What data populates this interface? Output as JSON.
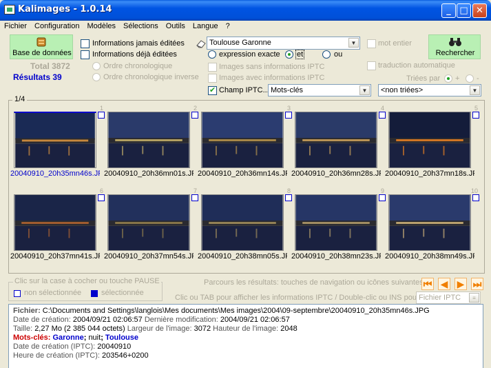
{
  "window": {
    "title": "Kalimages - 1.0.14",
    "min": "_",
    "max": "□",
    "close": "✕"
  },
  "menu": [
    "Fichier",
    "Configuration",
    "Modèles",
    "Sélections",
    "Outils",
    "Langue",
    "?"
  ],
  "left_panel": {
    "database_button": "Base de données",
    "total_label": "Total",
    "total_value": "3872",
    "results_label": "Résultats",
    "results_value": "39",
    "never_edited": "Informations jamais éditées",
    "already_edited": "Informations déjà éditées",
    "chrono_order": "Ordre chronologique",
    "chrono_reverse": "Ordre chronologique inverse"
  },
  "search": {
    "query": "Toulouse Garonne",
    "exact_expression": "expression exacte",
    "and_label": "et",
    "or_label": "ou",
    "whole_word": "mot entier",
    "auto_translate": "traduction automatique",
    "search_button": "Rechercher",
    "without_iptc": "Images sans informations IPTC",
    "with_iptc": "Images avec informations IPTC",
    "iptc_field_label": "Champ IPTC...",
    "iptc_field_value": "Mots-clés",
    "sort_label": "Triées par",
    "sort_plus": "+",
    "sort_minus": "-",
    "sort_value": "<non triées>"
  },
  "gallery": {
    "page": "1/4",
    "thumbs": [
      {
        "num": "1",
        "name": "20040910_20h35mn46s.JPG",
        "selected": true
      },
      {
        "num": "2",
        "name": "20040910_20h36mn01s.JPG",
        "selected": false
      },
      {
        "num": "3",
        "name": "20040910_20h36mn14s.JPG",
        "selected": false
      },
      {
        "num": "4",
        "name": "20040910_20h36mn28s.JPG",
        "selected": false
      },
      {
        "num": "5",
        "name": "20040910_20h37mn18s.JPG",
        "selected": false
      },
      {
        "num": "6",
        "name": "20040910_20h37mn41s.JPG",
        "selected": false
      },
      {
        "num": "7",
        "name": "20040910_20h37mn54s.JPG",
        "selected": false
      },
      {
        "num": "8",
        "name": "20040910_20h38mn05s.JPG",
        "selected": false
      },
      {
        "num": "9",
        "name": "20040910_20h38mn23s.JPG",
        "selected": false
      },
      {
        "num": "10",
        "name": "20040910_20h38mn49s.JPG",
        "selected": false
      }
    ]
  },
  "legend": {
    "title": "Clic sur la case à cocher ou touche PAUSE",
    "not_selected": "non sélectionnée",
    "selected": "sélectionnée"
  },
  "navigation": {
    "hint1": "Parcours les résultats: touches de navigation ou icônes suivantes",
    "hint2": "Clic ou TAB pour afficher les informations IPTC / Double-clic ou INS pour",
    "iptc_input": "Fichier IPTC"
  },
  "info": {
    "file_label": "Fichier:",
    "file_path": "C:\\Documents and Settings\\langlois\\Mes documents\\Mes images\\2004\\09-septembre\\20040910_20h35mn46s.JPG",
    "created_label": "Date de création:",
    "created_value": "2004/09/21 02:06:57",
    "modified_label": "Dernière modification:",
    "modified_value": "2004/09/21 02:06:57",
    "size_label": "Taille:",
    "size_value": "2,27 Mo (2 385 044 octets)",
    "width_label": "Largeur de l'image:",
    "width_value": "3072",
    "height_label": "Hauteur de l'image:",
    "height_value": "2048",
    "keywords_label": "Mots-clés:",
    "kw1": "Garonne",
    "kw2": "nuit",
    "kw3": "Toulouse",
    "iptc_date_label": "Date de création (IPTC):",
    "iptc_date_value": "20040910",
    "iptc_time_label": "Heure de création (IPTC):",
    "iptc_time_value": "203546+0200"
  },
  "colors": {
    "titlebar": "#0054e3",
    "green_button": "#b9f0b4",
    "accent_blue": "#0000cc",
    "keyword_red": "#cc0000",
    "nav_orange": "#f07f00"
  }
}
